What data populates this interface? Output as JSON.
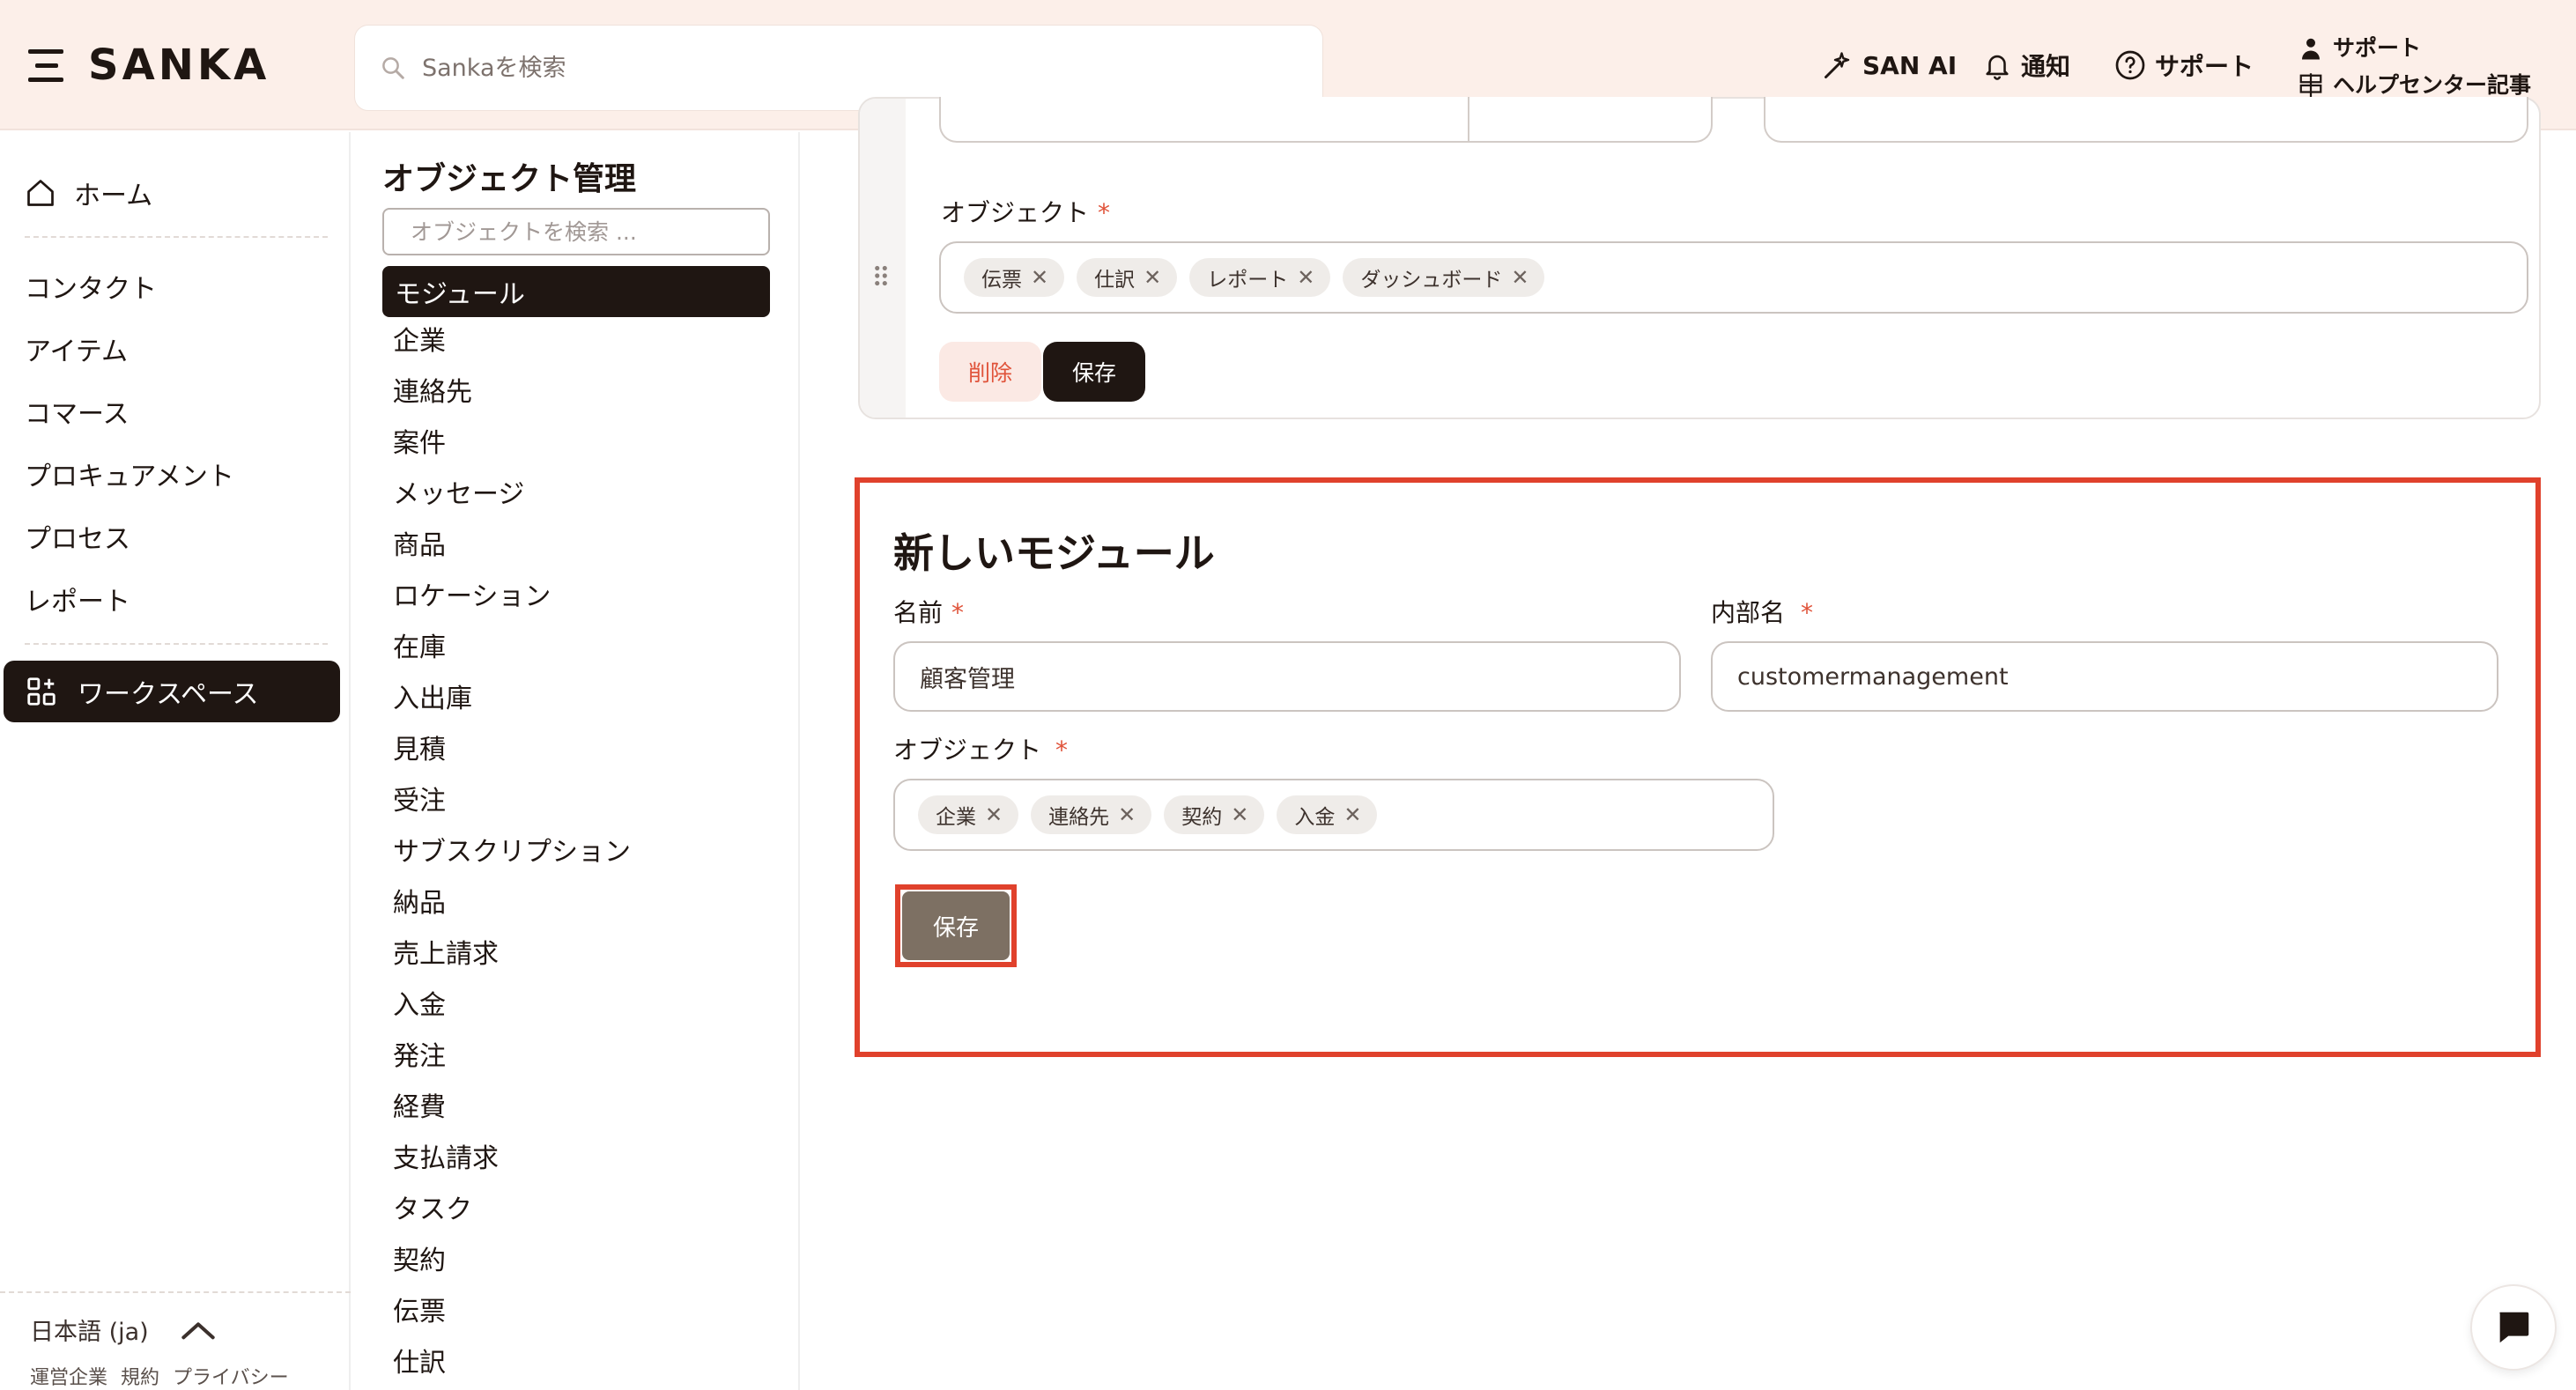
{
  "header": {
    "brand": "SANKA",
    "search_placeholder": "Sankaを検索",
    "ai_label": "SAN AI",
    "notify_label": "通知",
    "support_label": "サポート",
    "help_support_label": "サポート",
    "help_center_label": "ヘルプセンター記事"
  },
  "leftnav": {
    "home": "ホーム",
    "items": [
      "コンタクト",
      "アイテム",
      "コマース",
      "プロキュアメント",
      "プロセス",
      "レポート"
    ],
    "workspace": "ワークスペース",
    "language": "日本語 (ja)",
    "footer": [
      "運営企業",
      "規約",
      "プライバシー"
    ]
  },
  "objects": {
    "title": "オブジェクト管理",
    "search_placeholder": "オブジェクトを検索 ...",
    "active": "モジュール",
    "items": [
      "企業",
      "連絡先",
      "案件",
      "メッセージ",
      "商品",
      "ロケーション",
      "在庫",
      "入出庫",
      "見積",
      "受注",
      "サブスクリプション",
      "納品",
      "売上請求",
      "入金",
      "発注",
      "経費",
      "支払請求",
      "タスク",
      "契約",
      "伝票",
      "仕訳"
    ]
  },
  "existing_module": {
    "object_label": "オブジェクト",
    "tags": [
      "伝票",
      "仕訳",
      "レポート",
      "ダッシュボード"
    ],
    "delete_label": "削除",
    "save_label": "保存"
  },
  "new_module": {
    "title": "新しいモジュール",
    "name_label": "名前",
    "name_value": "顧客管理",
    "internal_label": "内部名",
    "internal_value": "customermanagement",
    "object_label": "オブジェクト",
    "tags": [
      "企業",
      "連絡先",
      "契約",
      "入金"
    ],
    "required_mark": "*",
    "save_label": "保存"
  },
  "colors": {
    "header_bg": "#fcefe9",
    "dark": "#1f1612",
    "accent_red": "#e0412c",
    "save_button": "#7d7063"
  }
}
